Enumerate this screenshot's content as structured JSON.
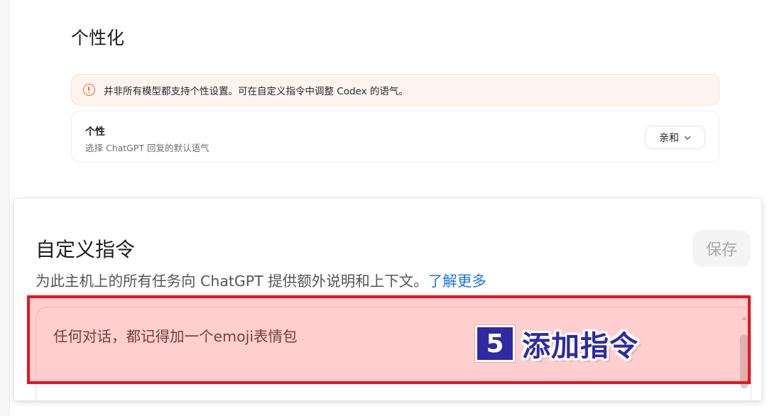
{
  "settings": {
    "page_title": "个性化",
    "warning": {
      "icon": "alert-circle-icon",
      "text": "并非所有模型都支持个性设置。可在自定义指令中调整 Codex 的语气。",
      "color": "#e2742b"
    },
    "personality": {
      "title": "个性",
      "description": "选择 ChatGPT 回复的默认语气",
      "selected": "亲和",
      "dropdown_icon": "chevron-down-icon"
    }
  },
  "custom_instructions": {
    "title": "自定义指令",
    "save_label": "保存",
    "description": "为此主机上的所有任务向 ChatGPT 提供额外说明和上下文。",
    "learn_more": "了解更多",
    "textarea_value": "任何对话，都记得加一个emoji表情包"
  },
  "annotation": {
    "step_number": "5",
    "step_text": "添加指令",
    "highlight_color": "#e8141c",
    "badge_color": "#2f2aa3"
  }
}
